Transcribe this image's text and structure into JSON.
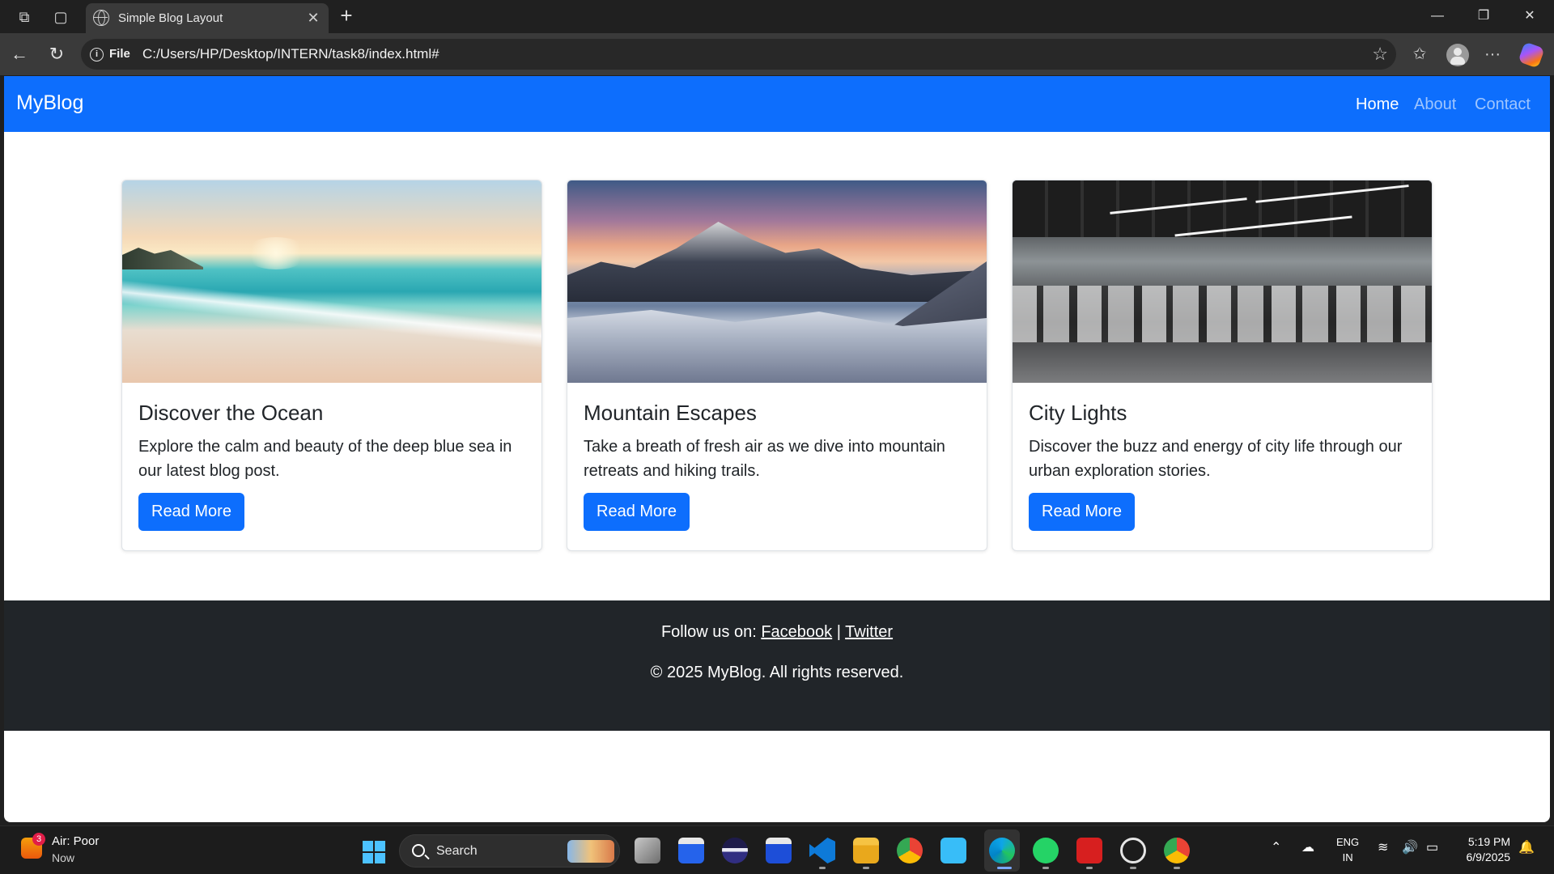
{
  "browser": {
    "tab_title": "Simple Blog Layout",
    "url_scheme": "File",
    "url": "C:/Users/HP/Desktop/INTERN/task8/index.html#"
  },
  "page": {
    "brand": "MyBlog",
    "nav": [
      "Home",
      "About",
      "Contact"
    ],
    "cards": [
      {
        "title": "Discover the Ocean",
        "text": "Explore the calm and beauty of the deep blue sea in our latest blog post.",
        "button": "Read More"
      },
      {
        "title": "Mountain Escapes",
        "text": "Take a breath of fresh air as we dive into mountain retreats and hiking trails.",
        "button": "Read More"
      },
      {
        "title": "City Lights",
        "text": "Discover the buzz and energy of city life through our urban exploration stories.",
        "button": "Read More"
      }
    ],
    "footer": {
      "follow_prefix": "Follow us on:",
      "facebook": "Facebook",
      "separator": "|",
      "twitter": "Twitter",
      "copyright": "© 2025 MyBlog. All rights reserved."
    },
    "colors": {
      "primary": "#0d6efd",
      "footer_bg": "#212529"
    }
  },
  "taskbar": {
    "weather_badge": "3",
    "weather_title": "Air: Poor",
    "weather_sub": "Now",
    "search": "Search",
    "lang_line1": "ENG",
    "lang_line2": "IN",
    "time": "5:19 PM",
    "date": "6/9/2025"
  }
}
